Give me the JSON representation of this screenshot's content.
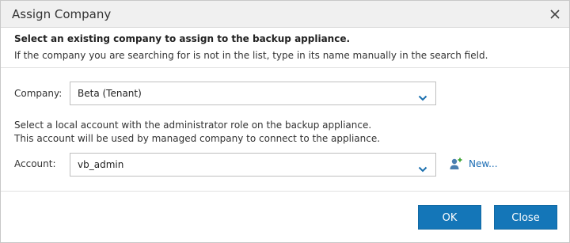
{
  "dialog": {
    "title": "Assign Company"
  },
  "header": {
    "title": "Select an existing company to assign to the backup appliance.",
    "description": "If the company you are searching for is not in the list, type in its name manually in the search field."
  },
  "company": {
    "label": "Company:",
    "value": "Beta (Tenant)"
  },
  "info": {
    "line1": "Select a local account with the administrator role on the backup appliance.",
    "line2": "This account will be used by managed company to connect to the appliance."
  },
  "account": {
    "label": "Account:",
    "value": "vb_admin",
    "new_label": "New..."
  },
  "buttons": {
    "ok": "OK",
    "close": "Close"
  },
  "colors": {
    "accent": "#1476b8",
    "link": "#1b6cb4"
  }
}
